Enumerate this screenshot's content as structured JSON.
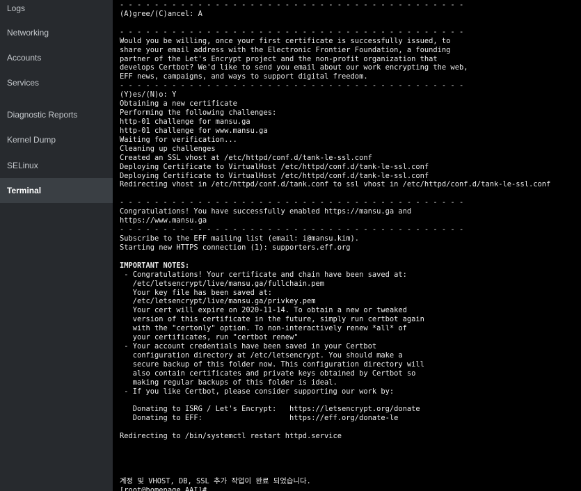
{
  "sidebar": {
    "items": [
      {
        "label": "Logs",
        "active": false
      },
      {
        "label": "Networking",
        "active": false
      },
      {
        "label": "Accounts",
        "active": false
      },
      {
        "label": "Services",
        "active": false
      },
      {
        "label": "Diagnostic Reports",
        "active": false
      },
      {
        "label": "Kernel Dump",
        "active": false
      },
      {
        "label": "SELinux",
        "active": false
      },
      {
        "label": "Terminal",
        "active": true
      }
    ]
  },
  "terminal": {
    "lines": [
      "- - - - - - - - - - - - - - - - - - - - - - - - - - - - - - - - - - - - - - - -",
      "(A)gree/(C)ancel: A",
      "",
      "- - - - - - - - - - - - - - - - - - - - - - - - - - - - - - - - - - - - - - - -",
      "Would you be willing, once your first certificate is successfully issued, to",
      "share your email address with the Electronic Frontier Foundation, a founding",
      "partner of the Let's Encrypt project and the non-profit organization that",
      "develops Certbot? We'd like to send you email about our work encrypting the web,",
      "EFF news, campaigns, and ways to support digital freedom.",
      "- - - - - - - - - - - - - - - - - - - - - - - - - - - - - - - - - - - - - - - -",
      "(Y)es/(N)o: Y",
      "Obtaining a new certificate",
      "Performing the following challenges:",
      "http-01 challenge for mansu.ga",
      "http-01 challenge for www.mansu.ga",
      "Waiting for verification...",
      "Cleaning up challenges",
      "Created an SSL vhost at /etc/httpd/conf.d/tank-le-ssl.conf",
      "Deploying Certificate to VirtualHost /etc/httpd/conf.d/tank-le-ssl.conf",
      "Deploying Certificate to VirtualHost /etc/httpd/conf.d/tank-le-ssl.conf",
      "Redirecting vhost in /etc/httpd/conf.d/tank.conf to ssl vhost in /etc/httpd/conf.d/tank-le-ssl.conf",
      "",
      "- - - - - - - - - - - - - - - - - - - - - - - - - - - - - - - - - - - - - - - -",
      "Congratulations! You have successfully enabled https://mansu.ga and",
      "https://www.mansu.ga",
      "- - - - - - - - - - - - - - - - - - - - - - - - - - - - - - - - - - - - - - - -",
      "Subscribe to the EFF mailing list (email: i@mansu.kim).",
      "Starting new HTTPS connection (1): supporters.eff.org",
      "",
      "IMPORTANT NOTES:",
      " - Congratulations! Your certificate and chain have been saved at:",
      "   /etc/letsencrypt/live/mansu.ga/fullchain.pem",
      "   Your key file has been saved at:",
      "   /etc/letsencrypt/live/mansu.ga/privkey.pem",
      "   Your cert will expire on 2020-11-14. To obtain a new or tweaked",
      "   version of this certificate in the future, simply run certbot again",
      "   with the \"certonly\" option. To non-interactively renew *all* of",
      "   your certificates, run \"certbot renew\"",
      " - Your account credentials have been saved in your Certbot",
      "   configuration directory at /etc/letsencrypt. You should make a",
      "   secure backup of this folder now. This configuration directory will",
      "   also contain certificates and private keys obtained by Certbot so",
      "   making regular backups of this folder is ideal.",
      " - If you like Certbot, please consider supporting our work by:",
      "",
      "   Donating to ISRG / Let's Encrypt:   https://letsencrypt.org/donate",
      "   Donating to EFF:                    https://eff.org/donate-le",
      "",
      "Redirecting to /bin/systemctl restart httpd.service",
      "",
      "",
      "",
      "",
      "계정 및 VHOST, DB, SSL 추가 작업이 완료 되었습니다.",
      "[root@homepage AAI]#"
    ],
    "bold_line_index": 29,
    "prompt_line_index": 54
  },
  "colors": {
    "sidebar_bg": "#272a2e",
    "sidebar_active_bg": "#3a3f44",
    "sidebar_text": "#c4c8cc",
    "terminal_bg": "#000000",
    "terminal_text": "#ececec"
  }
}
